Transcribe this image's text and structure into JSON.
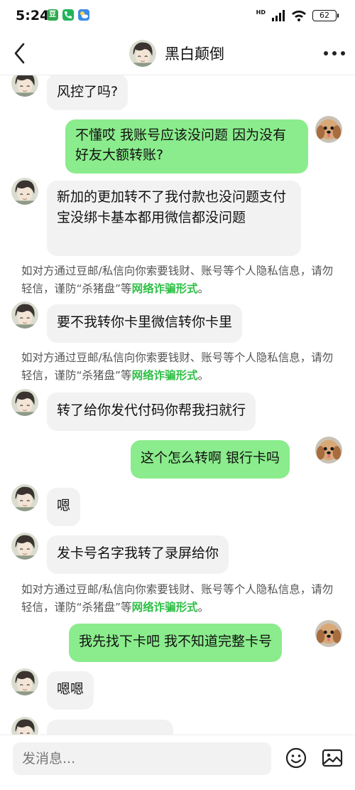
{
  "status_bar": {
    "time": "5:24",
    "app_icon_1": "豆",
    "network": "HD",
    "battery": "62"
  },
  "header": {
    "title": "黑白颠倒"
  },
  "messages": [
    {
      "side": "in",
      "text": "风控了吗?"
    },
    {
      "side": "out",
      "text": "不懂哎  我账号应该没问题 因为没有好友大额转账?"
    },
    {
      "side": "in",
      "text": "新加的更加转不了我付款也没问题支付宝没绑卡基本都用微信都没问题"
    },
    {
      "side": "in",
      "text": "要不我转你卡里微信转你卡里"
    },
    {
      "side": "in",
      "text": "转了给你发代付码你帮我扫就行"
    },
    {
      "side": "out",
      "text": "这个怎么转啊 银行卡吗"
    },
    {
      "side": "in",
      "text": "嗯"
    },
    {
      "side": "in",
      "text": "发卡号名字我转了录屏给你"
    },
    {
      "side": "out",
      "text": "我先找下卡吧 我不知道完整卡号"
    },
    {
      "side": "in",
      "text": "嗯嗯"
    }
  ],
  "notice": {
    "text": "如对方通过豆邮/私信向你索要钱财、账号等个人隐私信息，请勿轻信，谨防“杀猪盘”等",
    "link": "网络诈骗形式",
    "end": "。"
  },
  "input": {
    "placeholder": "发消息..."
  },
  "icons": {
    "back": "chevron-left-icon",
    "more": "more-dots-icon",
    "emoji": "emoji-icon",
    "image": "image-icon"
  },
  "colors": {
    "outgoing_bubble": "#8aec8c",
    "incoming_bubble": "#f2f2f2",
    "link": "#2dbf45"
  }
}
